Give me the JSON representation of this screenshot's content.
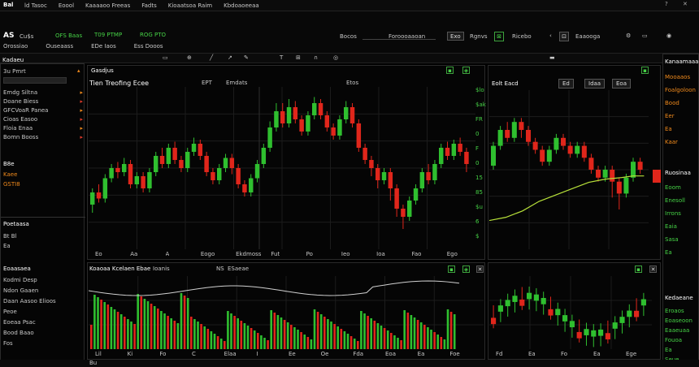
{
  "colors": {
    "up": "#2fbf2f",
    "down": "#e0261b",
    "accent_orange": "#f08a1c",
    "ma_line": "#b8e23a",
    "bg": "#000000",
    "grid": "#1c1c1c"
  },
  "menubar": {
    "logo": "Bal",
    "items": [
      "ld Tasoc",
      "Eoool",
      "Kaaaaoo Freeas",
      "Fadts",
      "Kioaatsoa Raim",
      "Kbdoaoeeaa"
    ]
  },
  "toolbar": {
    "symbol": "AS",
    "symbol_sub": "Cu$s",
    "item1": "OFS Baas",
    "item2": "T09 PTMP",
    "item3": "ROG PTO",
    "row2": [
      "Orossiao",
      "Ouseaass",
      "EDe Iaos",
      "Ess Dooos"
    ],
    "search_label": "Bocos",
    "search_value": "Foroooaaoan",
    "btn1": "Exo",
    "btn2": "Rgnvs",
    "btn3": "Ricebo",
    "btn4": "Eaaooga"
  },
  "left_panel": {
    "header": "Kadaeu",
    "field": "3u Pmrt",
    "rows": [
      {
        "label": "Emdg Siltna",
        "value": ""
      },
      {
        "label": "Doane Biess",
        "value": ""
      },
      {
        "label": "GFCVoaR Panea",
        "value": ""
      },
      {
        "label": "Cioas Easoo",
        "value": ""
      },
      {
        "label": "Floia Enaa",
        "value": ""
      },
      {
        "label": "Bomn Booss",
        "value": ""
      }
    ],
    "sub_header": "B8e",
    "sub_rows": [
      "Kaee",
      "GSTI8"
    ],
    "section": "Poetaasa",
    "section_rows": [
      "Bt  Bl",
      "Ea"
    ],
    "bottom_header": "Eoaasaea",
    "bottom_rows": [
      "Kodmi Desp",
      "Ndon Gaaen",
      "Daan Aasoo Elioos",
      "Peoe",
      "Eoeaa Psac",
      "Bood Baao",
      "Fos"
    ]
  },
  "chart_main": {
    "title": "Gasdjus",
    "subtitle": "Tien Treofing Ecee",
    "price_tag": "EPT",
    "label2": "Emdats",
    "label3": "Etos",
    "scale": [
      "$lo",
      "$ak",
      "FR",
      "0",
      "F",
      "0",
      "15",
      "85",
      "$u",
      "6",
      "$"
    ],
    "x_labels": [
      "Eo",
      "Aa",
      "A",
      "Eogo",
      "Ekdmoss",
      "Fut",
      "Po",
      "Ieo",
      "Ioa",
      "Fao",
      "Ego"
    ],
    "candles": [
      [
        42,
        48,
        38,
        50,
        1
      ],
      [
        48,
        45,
        43,
        52,
        0
      ],
      [
        45,
        55,
        43,
        57,
        1
      ],
      [
        55,
        60,
        53,
        62,
        1
      ],
      [
        60,
        58,
        55,
        63,
        0
      ],
      [
        58,
        62,
        56,
        65,
        1
      ],
      [
        62,
        52,
        50,
        64,
        0
      ],
      [
        52,
        56,
        50,
        58,
        1
      ],
      [
        56,
        50,
        48,
        58,
        0
      ],
      [
        50,
        58,
        48,
        60,
        1
      ],
      [
        58,
        66,
        56,
        68,
        1
      ],
      [
        66,
        62,
        60,
        70,
        0
      ],
      [
        62,
        70,
        60,
        72,
        1
      ],
      [
        70,
        64,
        62,
        73,
        0
      ],
      [
        64,
        60,
        58,
        66,
        0
      ],
      [
        60,
        68,
        58,
        70,
        1
      ],
      [
        68,
        72,
        66,
        75,
        1
      ],
      [
        72,
        66,
        64,
        74,
        0
      ],
      [
        66,
        58,
        56,
        68,
        0
      ],
      [
        58,
        54,
        52,
        60,
        0
      ],
      [
        54,
        60,
        52,
        62,
        1
      ],
      [
        60,
        65,
        58,
        67,
        1
      ],
      [
        65,
        60,
        57,
        67,
        0
      ],
      [
        60,
        52,
        50,
        62,
        0
      ],
      [
        52,
        48,
        46,
        54,
        0
      ],
      [
        48,
        55,
        46,
        57,
        1
      ],
      [
        55,
        62,
        53,
        64,
        1
      ],
      [
        62,
        70,
        60,
        72,
        1
      ],
      [
        70,
        80,
        68,
        83,
        1
      ],
      [
        80,
        88,
        78,
        92,
        1
      ],
      [
        88,
        82,
        80,
        92,
        0
      ],
      [
        82,
        90,
        80,
        94,
        1
      ],
      [
        90,
        84,
        82,
        93,
        0
      ],
      [
        84,
        78,
        76,
        86,
        0
      ],
      [
        78,
        86,
        76,
        88,
        1
      ],
      [
        86,
        92,
        84,
        95,
        1
      ],
      [
        92,
        86,
        84,
        94,
        0
      ],
      [
        86,
        80,
        78,
        88,
        0
      ],
      [
        80,
        76,
        74,
        82,
        0
      ],
      [
        76,
        84,
        74,
        86,
        1
      ],
      [
        84,
        90,
        82,
        93,
        1
      ],
      [
        90,
        82,
        80,
        92,
        0
      ],
      [
        82,
        70,
        68,
        84,
        0
      ],
      [
        70,
        64,
        62,
        72,
        0
      ],
      [
        64,
        60,
        56,
        66,
        0
      ],
      [
        60,
        54,
        50,
        62,
        0
      ],
      [
        54,
        58,
        52,
        60,
        1
      ],
      [
        58,
        50,
        44,
        60,
        0
      ],
      [
        50,
        40,
        36,
        52,
        0
      ],
      [
        40,
        36,
        30,
        42,
        0
      ],
      [
        36,
        44,
        34,
        46,
        1
      ],
      [
        44,
        50,
        42,
        52,
        1
      ],
      [
        50,
        58,
        48,
        60,
        1
      ],
      [
        58,
        54,
        52,
        62,
        0
      ],
      [
        54,
        62,
        52,
        64,
        1
      ],
      [
        62,
        70,
        60,
        72,
        1
      ],
      [
        70,
        66,
        64,
        73,
        0
      ],
      [
        66,
        72,
        64,
        74,
        1
      ],
      [
        72,
        68,
        66,
        75,
        0
      ],
      [
        68,
        62,
        58,
        70,
        0
      ]
    ],
    "candles2": [
      [
        62,
        72,
        60,
        74,
        1
      ],
      [
        72,
        80,
        70,
        82,
        1
      ],
      [
        80,
        76,
        74,
        84,
        0
      ],
      [
        76,
        84,
        74,
        86,
        1
      ],
      [
        84,
        80,
        76,
        86,
        0
      ],
      [
        80,
        74,
        72,
        82,
        0
      ],
      [
        74,
        70,
        68,
        76,
        0
      ],
      [
        70,
        64,
        62,
        72,
        0
      ],
      [
        64,
        70,
        62,
        72,
        1
      ],
      [
        70,
        76,
        68,
        78,
        1
      ],
      [
        76,
        72,
        70,
        78,
        0
      ],
      [
        72,
        68,
        66,
        74,
        0
      ],
      [
        68,
        72,
        66,
        74,
        1
      ],
      [
        72,
        66,
        64,
        74,
        0
      ],
      [
        66,
        60,
        58,
        68,
        0
      ],
      [
        60,
        56,
        54,
        62,
        0
      ],
      [
        56,
        60,
        54,
        62,
        1
      ],
      [
        60,
        54,
        46,
        62,
        0
      ],
      [
        54,
        48,
        40,
        56,
        0
      ],
      [
        48,
        56,
        46,
        58,
        1
      ],
      [
        56,
        64,
        54,
        66,
        1
      ],
      [
        64,
        60,
        58,
        66,
        0
      ]
    ],
    "ma_line": [
      [
        0,
        14
      ],
      [
        6,
        16
      ],
      [
        12,
        20
      ],
      [
        18,
        26
      ],
      [
        24,
        30
      ],
      [
        30,
        34
      ],
      [
        36,
        38
      ],
      [
        42,
        40
      ],
      [
        48,
        41
      ],
      [
        52,
        42
      ],
      [
        56,
        42
      ]
    ]
  },
  "chart_lower": {
    "title": "Koaoaa Kcelaen Ebae",
    "title_suffix": "Ioanis",
    "tag1": "NS",
    "tag2": "ESaeae",
    "x_labels": [
      "Lil",
      "Ki",
      "Fo",
      "C",
      "Elaa",
      "I",
      "Ee",
      "Oe",
      "Fda",
      "Eoa",
      "Ea",
      "Foe"
    ]
  },
  "right_panel": {
    "header": "Kanaamaaa",
    "items": [
      "Mooaaos",
      "Foalgoloon",
      "Bood",
      "Eer",
      "Ea",
      "Kaar"
    ],
    "sub_header": "Ruosinaa",
    "sub_rows": [
      "Eoom",
      "Enesoll",
      "Irrons",
      "Eaia",
      "Sasa",
      "Ea"
    ],
    "bottom_header": "Kedaeane",
    "bottom_rows": [
      "Eroaos",
      "Eoaseoon",
      "Eaaeuaa",
      "Fouoa",
      "Ea",
      "Seue"
    ]
  },
  "chart_right_top": {
    "title": "Eolt Eacd",
    "btn1": "Ed",
    "btn2": "Idaa",
    "btn3": "Eoa"
  },
  "chart_right_bottom": {
    "x_labels": [
      "Fd",
      "Ea",
      "Fo",
      "Ea",
      "Ege"
    ]
  },
  "statusbar": {
    "text": "Bu"
  }
}
